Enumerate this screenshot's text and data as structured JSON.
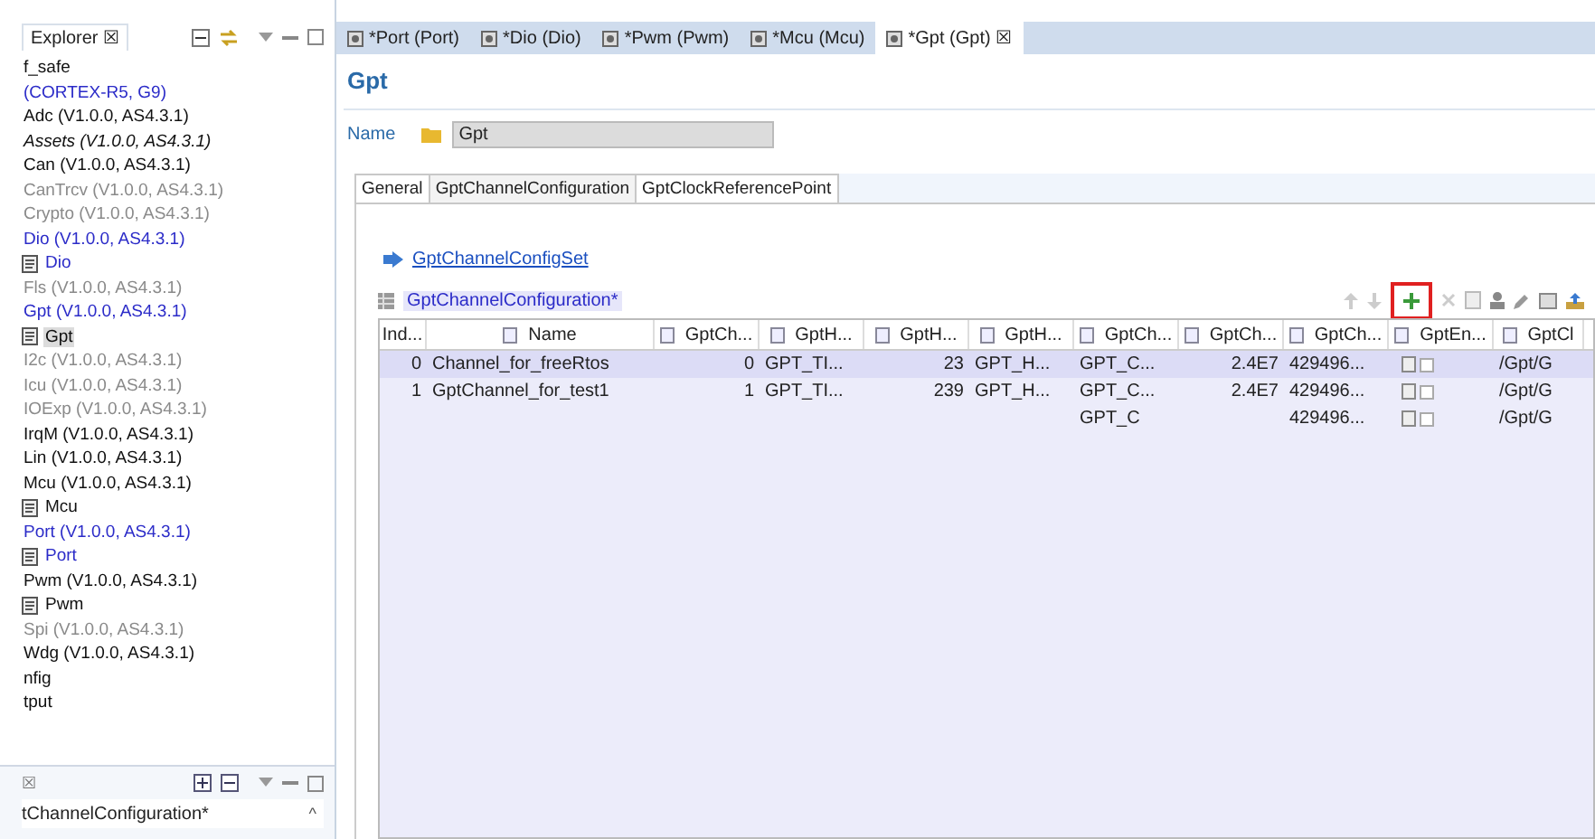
{
  "explorer": {
    "title": "Explorer ☒",
    "items": [
      {
        "label": "f_safe",
        "kind": "normal",
        "icon": false,
        "selected": false
      },
      {
        "label": " (CORTEX-R5, G9)",
        "kind": "blue",
        "icon": false,
        "selected": false
      },
      {
        "label": "Adc (V1.0.0, AS4.3.1)",
        "kind": "normal",
        "icon": false,
        "selected": false
      },
      {
        "label": "Assets (V1.0.0, AS4.3.1)",
        "kind": "italic",
        "icon": false,
        "selected": false
      },
      {
        "label": "Can (V1.0.0, AS4.3.1)",
        "kind": "normal",
        "icon": false,
        "selected": false
      },
      {
        "label": "CanTrcv (V1.0.0, AS4.3.1)",
        "kind": "gray",
        "icon": false,
        "selected": false
      },
      {
        "label": "Crypto (V1.0.0, AS4.3.1)",
        "kind": "gray",
        "icon": false,
        "selected": false
      },
      {
        "label": "Dio (V1.0.0, AS4.3.1)",
        "kind": "blue",
        "icon": false,
        "selected": false
      },
      {
        "label": "Dio",
        "kind": "blue",
        "icon": true,
        "selected": false
      },
      {
        "label": "Fls (V1.0.0, AS4.3.1)",
        "kind": "gray",
        "icon": false,
        "selected": false
      },
      {
        "label": "Gpt (V1.0.0, AS4.3.1)",
        "kind": "blue",
        "icon": false,
        "selected": false
      },
      {
        "label": "Gpt",
        "kind": "normal",
        "icon": true,
        "selected": true
      },
      {
        "label": "I2c (V1.0.0, AS4.3.1)",
        "kind": "gray",
        "icon": false,
        "selected": false
      },
      {
        "label": "Icu (V1.0.0, AS4.3.1)",
        "kind": "gray",
        "icon": false,
        "selected": false
      },
      {
        "label": "IOExp (V1.0.0, AS4.3.1)",
        "kind": "gray",
        "icon": false,
        "selected": false
      },
      {
        "label": "IrqM (V1.0.0, AS4.3.1)",
        "kind": "normal",
        "icon": false,
        "selected": false
      },
      {
        "label": "Lin (V1.0.0, AS4.3.1)",
        "kind": "normal",
        "icon": false,
        "selected": false
      },
      {
        "label": "Mcu (V1.0.0, AS4.3.1)",
        "kind": "normal",
        "icon": false,
        "selected": false
      },
      {
        "label": "Mcu",
        "kind": "normal",
        "icon": true,
        "selected": false
      },
      {
        "label": "Port (V1.0.0, AS4.3.1)",
        "kind": "blue",
        "icon": false,
        "selected": false
      },
      {
        "label": "Port",
        "kind": "blue",
        "icon": true,
        "selected": false
      },
      {
        "label": "Pwm (V1.0.0, AS4.3.1)",
        "kind": "normal",
        "icon": false,
        "selected": false
      },
      {
        "label": "Pwm",
        "kind": "normal",
        "icon": true,
        "selected": false
      },
      {
        "label": "Spi (V1.0.0, AS4.3.1)",
        "kind": "gray",
        "icon": false,
        "selected": false
      },
      {
        "label": "Wdg (V1.0.0, AS4.3.1)",
        "kind": "normal",
        "icon": false,
        "selected": false
      },
      {
        "label": "nfig",
        "kind": "normal",
        "icon": false,
        "selected": false
      },
      {
        "label": "tput",
        "kind": "normal",
        "icon": false,
        "selected": false
      }
    ]
  },
  "outline": {
    "close": "☒",
    "item": "tChannelConfiguration*",
    "collapse": "^"
  },
  "editor_tabs": [
    {
      "label": "*Port (Port)",
      "selected": false
    },
    {
      "label": "*Dio (Dio)",
      "selected": false
    },
    {
      "label": "*Pwm (Pwm)",
      "selected": false
    },
    {
      "label": "*Mcu (Mcu)",
      "selected": false
    },
    {
      "label": "*Gpt (Gpt) ☒",
      "selected": true
    }
  ],
  "editor": {
    "title": "Gpt",
    "name_label": "Name",
    "name_value": "Gpt",
    "sub_tabs": [
      {
        "label": "General",
        "selected": false
      },
      {
        "label": "GptChannelConfiguration",
        "selected": true
      },
      {
        "label": "GptClockReferencePoint",
        "selected": false
      }
    ],
    "link": "GptChannelConfigSet",
    "section": "GptChannelConfiguration*",
    "table": {
      "columns": [
        "Ind...",
        "Name",
        "GptCh...",
        "GptH...",
        "GptH...",
        "GptH...",
        "GptCh...",
        "GptCh...",
        "GptCh...",
        "GptEn...",
        "GptCl"
      ],
      "rows": [
        {
          "selected": true,
          "cells": [
            "0",
            "Channel_for_freeRtos",
            "0",
            "GPT_TI...",
            "23",
            "GPT_H...",
            "GPT_C...",
            "2.4E7",
            "429496...",
            null,
            "/Gpt/G"
          ],
          "checked": false
        },
        {
          "selected": false,
          "cells": [
            "1",
            "GptChannel_for_test1",
            "1",
            "GPT_TI...",
            "239",
            "GPT_H...",
            "GPT_C...",
            "2.4E7",
            "429496...",
            null,
            "/Gpt/G"
          ],
          "checked": false
        },
        {
          "selected": false,
          "cells": [
            null,
            null,
            null,
            null,
            null,
            null,
            "GPT_C",
            null,
            "429496...",
            null,
            "/Gpt/G"
          ],
          "checked": false
        }
      ]
    }
  }
}
